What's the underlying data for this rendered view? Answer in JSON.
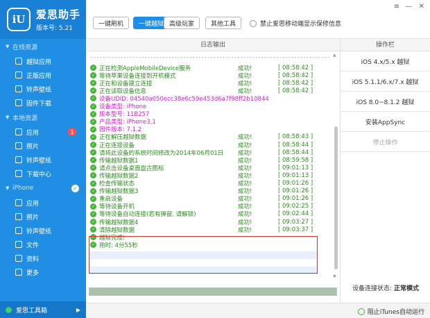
{
  "app": {
    "name": "爱思助手",
    "version": "版本号: 5.21",
    "logo_text": "iU"
  },
  "sidebar": {
    "sections": [
      {
        "label": "在线资源",
        "items": [
          {
            "label": "越狱应用",
            "icon": "jailbreak-app-icon"
          },
          {
            "label": "正版应用",
            "icon": "app-store-icon"
          },
          {
            "label": "铃声壁纸",
            "icon": "ringtone-icon"
          },
          {
            "label": "固件下载",
            "icon": "firmware-icon"
          }
        ]
      },
      {
        "label": "本地资源",
        "items": [
          {
            "label": "应用",
            "icon": "apps-icon",
            "badge": "1"
          },
          {
            "label": "照片",
            "icon": "photo-icon"
          },
          {
            "label": "铃声壁纸",
            "icon": "ringtone-icon"
          },
          {
            "label": "下载中心",
            "icon": "download-icon"
          }
        ]
      },
      {
        "label": "iPhone",
        "items": [
          {
            "label": "应用",
            "icon": "apps-icon"
          },
          {
            "label": "照片",
            "icon": "photo-icon"
          },
          {
            "label": "铃声壁纸",
            "icon": "ringtone-icon"
          },
          {
            "label": "文件",
            "icon": "file-icon"
          },
          {
            "label": "资料",
            "icon": "data-icon"
          },
          {
            "label": "更多",
            "icon": "more-icon"
          }
        ]
      }
    ],
    "footer": "爱思工具箱"
  },
  "toolbar": {
    "buttons": [
      "一键刷机",
      "一键越狱",
      "高级玩家",
      "其他工具"
    ],
    "active": "一键越狱",
    "radio_label": "禁止爱思移动端显示保修信息"
  },
  "log": {
    "header": "日志输出",
    "separator": "-------------------------------------------------------------------------------------------------------",
    "lines": [
      {
        "msg": "正在检测AppleMobileDevice服务",
        "result": "成功!",
        "time": "[ 08:58:42 ]"
      },
      {
        "msg": "等待苹果设备连接到开机模式",
        "result": "成功!",
        "time": "[ 08:58:42 ]"
      },
      {
        "msg": "正在和设备建立连接",
        "result": "成功!",
        "time": "[ 08:58:42 ]"
      },
      {
        "msg": "正在读取设备信息",
        "result": "成功!",
        "time": "[ 08:58:42 ]"
      },
      {
        "msg": "设备UDID: 04540a050ecc38e6c59e453d6a7f98ff2b10844",
        "info": true
      },
      {
        "msg": "设备类型: iPhone",
        "info": true
      },
      {
        "msg": "版本型号: 11B257",
        "info": true
      },
      {
        "msg": "产品类型: iPhone3,1",
        "info": true
      },
      {
        "msg": "固件版本: 7.1.2",
        "info": true
      },
      {
        "msg": "正在解压越狱数据",
        "result": "成功!",
        "time": "[ 08:58:43 ]"
      },
      {
        "msg": "正在连接设备",
        "result": "成功!",
        "time": "[ 08:58:44 ]"
      },
      {
        "msg": "请将此设备的系统时间修改为2014年06月01日",
        "result": "成功!",
        "time": "[ 08:58:44 ]"
      },
      {
        "msg": "传输越狱数据1",
        "result": "成功!",
        "time": "[ 08:59:58 ]"
      },
      {
        "msg": "请点击设备桌面盘古图标",
        "result": "成功!",
        "time": "[ 09:01:13 ]"
      },
      {
        "msg": "传输越狱数据2",
        "result": "成功!",
        "time": "[ 09:01:13 ]"
      },
      {
        "msg": "检查传输状态",
        "result": "成功!",
        "time": "[ 09:01:26 ]"
      },
      {
        "msg": "传输越狱数据3",
        "result": "成功!",
        "time": "[ 09:01:26 ]"
      },
      {
        "msg": "重启设备",
        "result": "成功!",
        "time": "[ 09:01:26 ]"
      },
      {
        "msg": "等待设备开机",
        "result": "成功!",
        "time": "[ 09:02:25 ]"
      },
      {
        "msg": "等待设备自动连接(若有弹窗, 请解锁)",
        "result": "成功!",
        "time": "[ 09:02:44 ]"
      },
      {
        "msg": "传输越狱数据4",
        "result": "成功!",
        "time": "[ 09:03:27 ]"
      },
      {
        "msg": "清除越狱数据",
        "result": "成功!",
        "time": "[ 09:03:37 ]"
      },
      {
        "msg": "越狱完成!",
        "info": false
      },
      {
        "msg": "用时: 4分55秒",
        "info": false
      }
    ],
    "progress": 1.0
  },
  "right_panel": {
    "header": "操作栏",
    "ops": [
      "iOS 4.x/5.x 越狱",
      "iOS 5.1.1/6.x/7.x 越狱",
      "iOS 8.0~8.1.2 越狱",
      "安装AppSync",
      "停止操作"
    ],
    "disabled": "停止操作",
    "status_label": "设备连接状态:",
    "status_value": "正常模式"
  },
  "statusbar": {
    "itunes": "阻止iTunes自动运行"
  },
  "colors": {
    "sidebar": "#1f8ee3",
    "accent": "#1f8ee3",
    "success": "#2e8b20",
    "info": "#d21fcf",
    "highlight": "#d83232"
  }
}
